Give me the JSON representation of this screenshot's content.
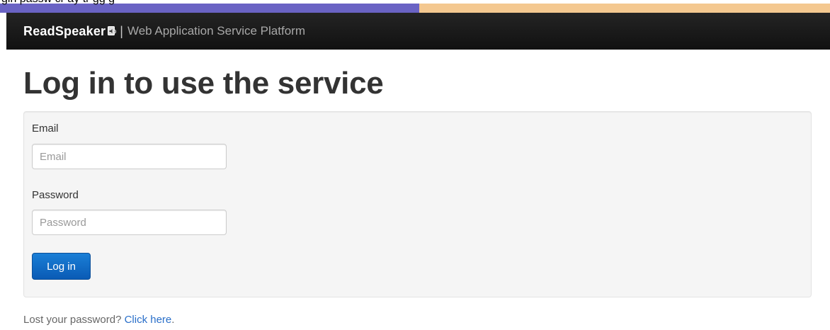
{
  "caption": {
    "text": "gin     passw    cr  ay tr  gg g"
  },
  "navbar": {
    "brand": "ReadSpeaker",
    "separator": "|",
    "platform": "Web Application Service Platform"
  },
  "page": {
    "title": "Log in to use the service"
  },
  "form": {
    "email_label": "Email",
    "email_placeholder": "Email",
    "email_value": "",
    "password_label": "Password",
    "password_placeholder": "Password",
    "password_value": "",
    "submit_label": "Log in"
  },
  "footer": {
    "lost_text": "Lost your password? ",
    "link_text": "Click here",
    "link_suffix": "."
  },
  "colors": {
    "navbar": "#1c1c1c",
    "primary_button": "#0a63c6",
    "link": "#2a6fc9",
    "well": "#f5f5f5"
  },
  "icons": {
    "brand_speaker": "speaker-icon"
  }
}
